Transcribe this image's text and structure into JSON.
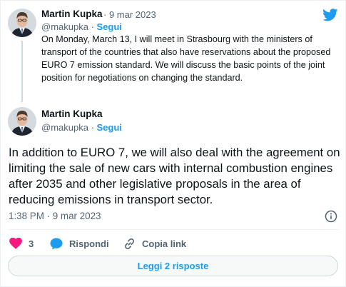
{
  "quoted_tweet": {
    "author_name": "Martin Kupka",
    "separator": " · ",
    "date": "9 mar 2023",
    "handle": "@makupka",
    "follow_label": "Segui",
    "text": "On Monday, March 13, I will meet in Strasbourg with the ministers of transport of the countries that also have reservations about the proposed EURO 7 emission standard. We will discuss the basic points of the joint position for negotiations on changing the standard."
  },
  "main_tweet": {
    "author_name": "Martin Kupka",
    "handle": "@makupka",
    "separator": " · ",
    "follow_label": "Segui",
    "text": "In addition to EURO 7, we will also deal with the agreement on limiting the sale of new cars with internal combustion engines after 2035 and other legislative proposals in the area of reducing emissions in transport sector.",
    "timestamp": "1:38 PM · 9 mar 2023"
  },
  "actions": {
    "like_count": "3",
    "reply_label": "Rispondi",
    "copy_link_label": "Copia link"
  },
  "replies_button_label": "Leggi 2 risposte",
  "icons": {
    "brand": "twitter-bird-icon",
    "like": "heart-icon",
    "reply": "speech-bubble-icon",
    "copy": "link-icon",
    "info": "info-icon"
  },
  "colors": {
    "accent": "#1d9bf0",
    "like": "#f91880",
    "secondary_text": "#536471",
    "primary_text": "#0f1419"
  }
}
